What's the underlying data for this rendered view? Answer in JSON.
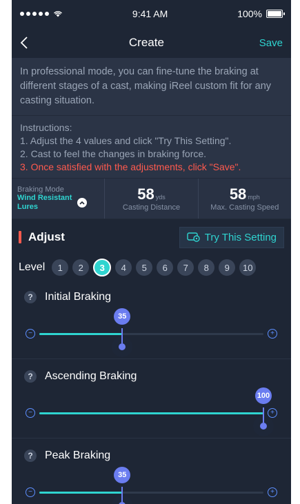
{
  "status": {
    "time": "9:41 AM",
    "battery": "100%"
  },
  "nav": {
    "title": "Create",
    "save": "Save"
  },
  "intro": "In professional mode, you can fine-tune the braking at different stages of a cast, making iReel custom fit for any casting situation.",
  "instructions": {
    "heading": "Instructions:",
    "step1": "1. Adjust the 4 values and click \"Try This Setting\".",
    "step2": "2. Cast to feel the changes in braking force.",
    "step3": "3. Once satisfied with the adjustments, click \"Save\"."
  },
  "stats": {
    "mode_label": "Braking Mode",
    "mode_value_line1": "Wind Resistant",
    "mode_value_line2": "Lures",
    "distance_value": "58",
    "distance_unit": "yds",
    "distance_label": "Casting Distance",
    "speed_value": "58",
    "speed_unit": "mph",
    "speed_label": "Max. Casting Speed"
  },
  "adjust": {
    "title": "Adjust",
    "try_label": "Try This Setting"
  },
  "levels": {
    "label": "Level",
    "items": [
      "1",
      "2",
      "3",
      "4",
      "5",
      "6",
      "7",
      "8",
      "9",
      "10"
    ],
    "active": 3
  },
  "sections": [
    {
      "title": "Initial Braking",
      "value": 35,
      "fraction": 0.37
    },
    {
      "title": "Ascending Braking",
      "value": 100,
      "fraction": 1.0
    },
    {
      "title": "Peak Braking",
      "value": 35,
      "fraction": 0.37
    }
  ],
  "colors": {
    "accent": "#2fd4d0",
    "highlight": "#ff5a4e",
    "knob": "#6b7df0"
  }
}
